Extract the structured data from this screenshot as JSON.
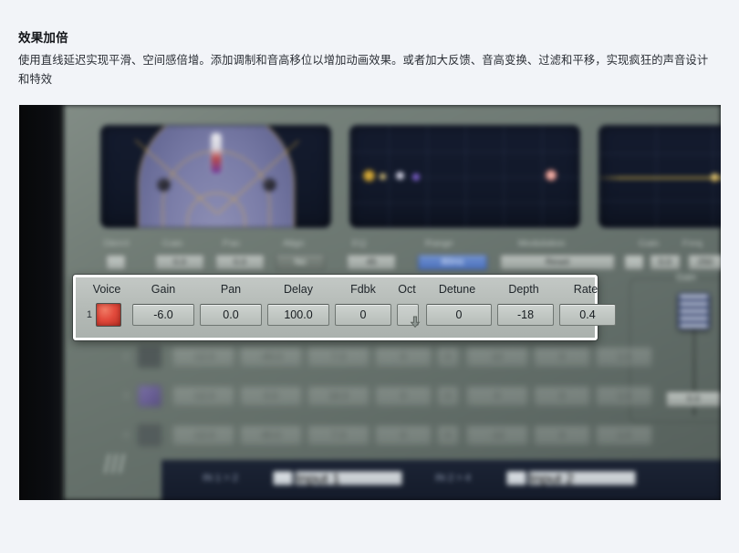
{
  "article": {
    "title": "效果加倍",
    "body": "使用直线延迟实现平滑、空间感倍增。添加调制和音高移位以增加动画效果。或者加大反馈、音高变换、过滤和平移，实现疯狂的声音设计和特效"
  },
  "screenshot": {
    "alt_name": "delay-plugin-screenshot",
    "top_strip": {
      "labels": [
        "Direct",
        "Gain",
        "Pan",
        "Align",
        "EQ",
        "Range",
        "Modulation",
        "Gain",
        "Freq"
      ],
      "values": [
        "",
        "0.0",
        "0.0",
        "No",
        "45",
        "80ms",
        "Reset",
        "0.0",
        "250"
      ]
    },
    "voice_table": {
      "highlighted": true,
      "columns": [
        "Voice",
        "Gain",
        "Pan",
        "Delay",
        "Fdbk",
        "Oct",
        "Detune",
        "Depth",
        "Rate"
      ],
      "rows": [
        {
          "index": "1",
          "swatch_color": "#e24a3c",
          "gain": "-6.0",
          "pan": "0.0",
          "delay": "100.0",
          "fdbk": "0",
          "oct": "down-arrow",
          "detune": "0",
          "depth": "-18",
          "rate": "0.4"
        },
        {
          "index": "2",
          "swatch_color": "#3b4146",
          "gain": "-12.0",
          "pan": "-40.0",
          "delay": "7.3",
          "fdbk": "0",
          "oct": "0",
          "detune": "12",
          "depth": "0",
          "rate": "1.0"
        },
        {
          "index": "3",
          "swatch_color": "#6c4fbf",
          "gain": "-12.0",
          "pan": "0.0",
          "delay": "16.0",
          "fdbk": "0",
          "oct": "0",
          "detune": "0",
          "depth": "0",
          "rate": "1.0"
        },
        {
          "index": "4",
          "swatch_color": "#454b50",
          "gain": "-12.0",
          "pan": "40.0",
          "delay": "7.3",
          "fdbk": "0",
          "oct": "0",
          "detune": "-12",
          "depth": "0",
          "rate": "1.0"
        }
      ]
    },
    "right_group": {
      "title": "Gain",
      "value": "0.0"
    },
    "bottom_bar": {
      "group1_label": "IN 1 > 2",
      "group1_value": "Input 1",
      "group2_label": "IN 2 > 4",
      "group2_value": "Input 2"
    },
    "colors": {
      "panel_metal": "#69756f",
      "screen_dark": "#111829",
      "highlight_border": "#ffffff",
      "voice1_red": "#e24a3c",
      "voice3_purple": "#6c4fbf",
      "accent_gold": "#d6a842",
      "accent_blue": "#4d71bb"
    }
  }
}
